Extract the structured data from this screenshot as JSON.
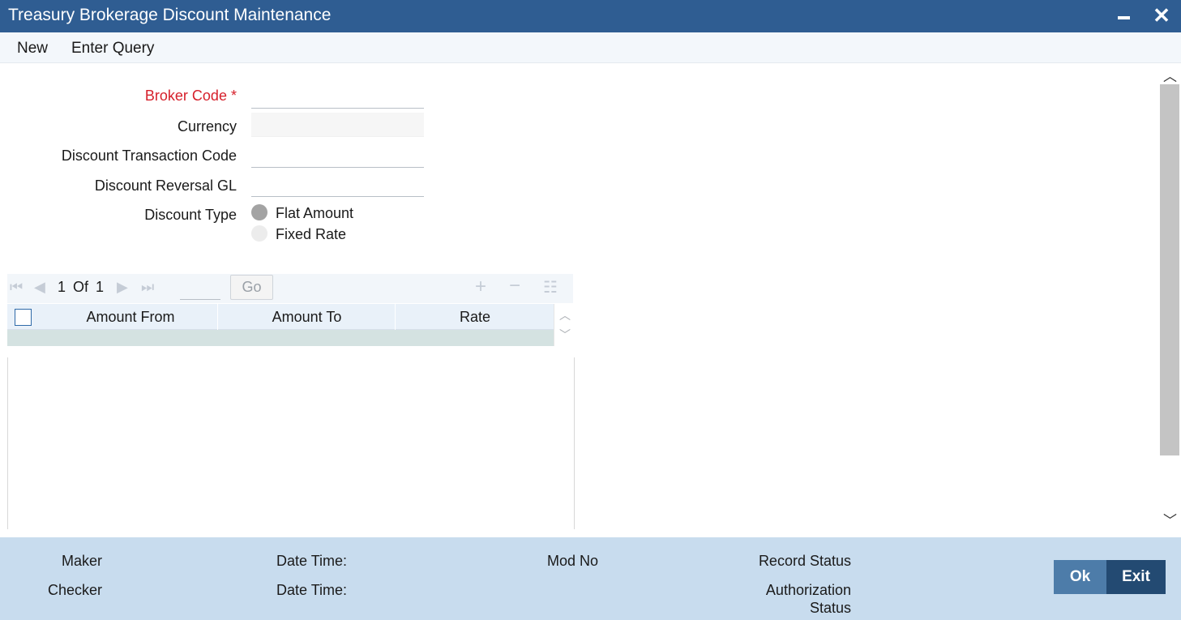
{
  "window": {
    "title": "Treasury Brokerage Discount Maintenance"
  },
  "menu": {
    "new": "New",
    "enter_query": "Enter Query"
  },
  "form": {
    "broker_code": {
      "label": "Broker Code",
      "required_mark": "*",
      "value": ""
    },
    "currency": {
      "label": "Currency",
      "value": ""
    },
    "discount_transaction_code": {
      "label": "Discount Transaction Code",
      "value": ""
    },
    "discount_reversal_gl": {
      "label": "Discount Reversal GL",
      "value": ""
    },
    "discount_type": {
      "label": "Discount Type",
      "options": [
        "Flat Amount",
        "Fixed Rate"
      ],
      "selected": "Flat Amount"
    }
  },
  "grid": {
    "pagination": {
      "current": "1",
      "of": "Of",
      "total": "1",
      "go": "Go"
    },
    "columns": [
      "Amount From",
      "Amount To",
      "Rate"
    ],
    "rows": []
  },
  "footer": {
    "maker": "Maker",
    "checker": "Checker",
    "date_time_1": "Date Time:",
    "date_time_2": "Date Time:",
    "mod_no": "Mod No",
    "record_status": "Record Status",
    "authorization_status_1": "Authorization",
    "authorization_status_2": "Status",
    "ok": "Ok",
    "exit": "Exit"
  },
  "colors": {
    "titlebar": "#2f5d92",
    "required": "#d6202b",
    "footer": "#c8dcee",
    "ok_button": "#4d7ca9",
    "exit_button": "#234a72"
  }
}
